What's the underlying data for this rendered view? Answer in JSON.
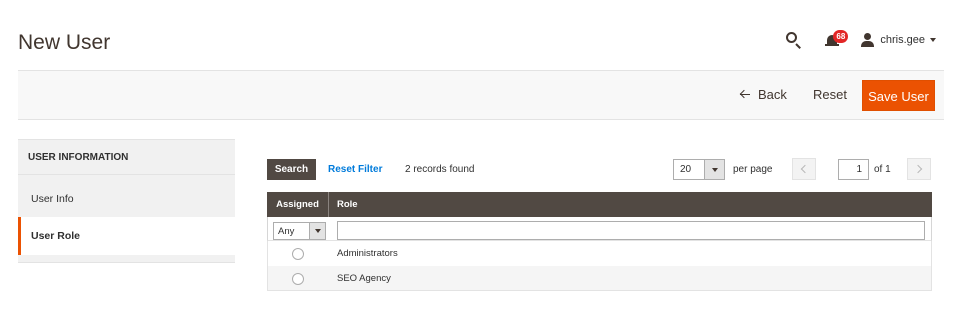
{
  "header": {
    "title": "New User",
    "notifications_count": "68",
    "username": "chris.gee"
  },
  "action_bar": {
    "back_label": "Back",
    "reset_label": "Reset",
    "save_label": "Save User"
  },
  "sidebar": {
    "heading": "USER INFORMATION",
    "tabs": [
      {
        "label": "User Info",
        "active": false
      },
      {
        "label": "User Role",
        "active": true
      }
    ]
  },
  "grid_toolbar": {
    "search_label": "Search",
    "reset_filter_label": "Reset Filter",
    "records_found": "2 records found",
    "per_page_value": "20",
    "per_page_label": "per page",
    "current_page": "1",
    "page_of": "of 1"
  },
  "grid": {
    "columns": [
      "Assigned",
      "Role"
    ],
    "filter": {
      "assigned_value": "Any",
      "role_value": ""
    },
    "rows": [
      {
        "assigned": false,
        "role": "Administrators"
      },
      {
        "assigned": false,
        "role": "SEO Agency"
      }
    ]
  },
  "colors": {
    "accent": "#eb5202",
    "dark_header": "#514943",
    "link": "#007bdb"
  },
  "icons": [
    "search-icon",
    "bell-icon",
    "user-icon",
    "arrow-left-icon",
    "chevron-left-icon",
    "chevron-right-icon",
    "chevron-down-icon"
  ]
}
